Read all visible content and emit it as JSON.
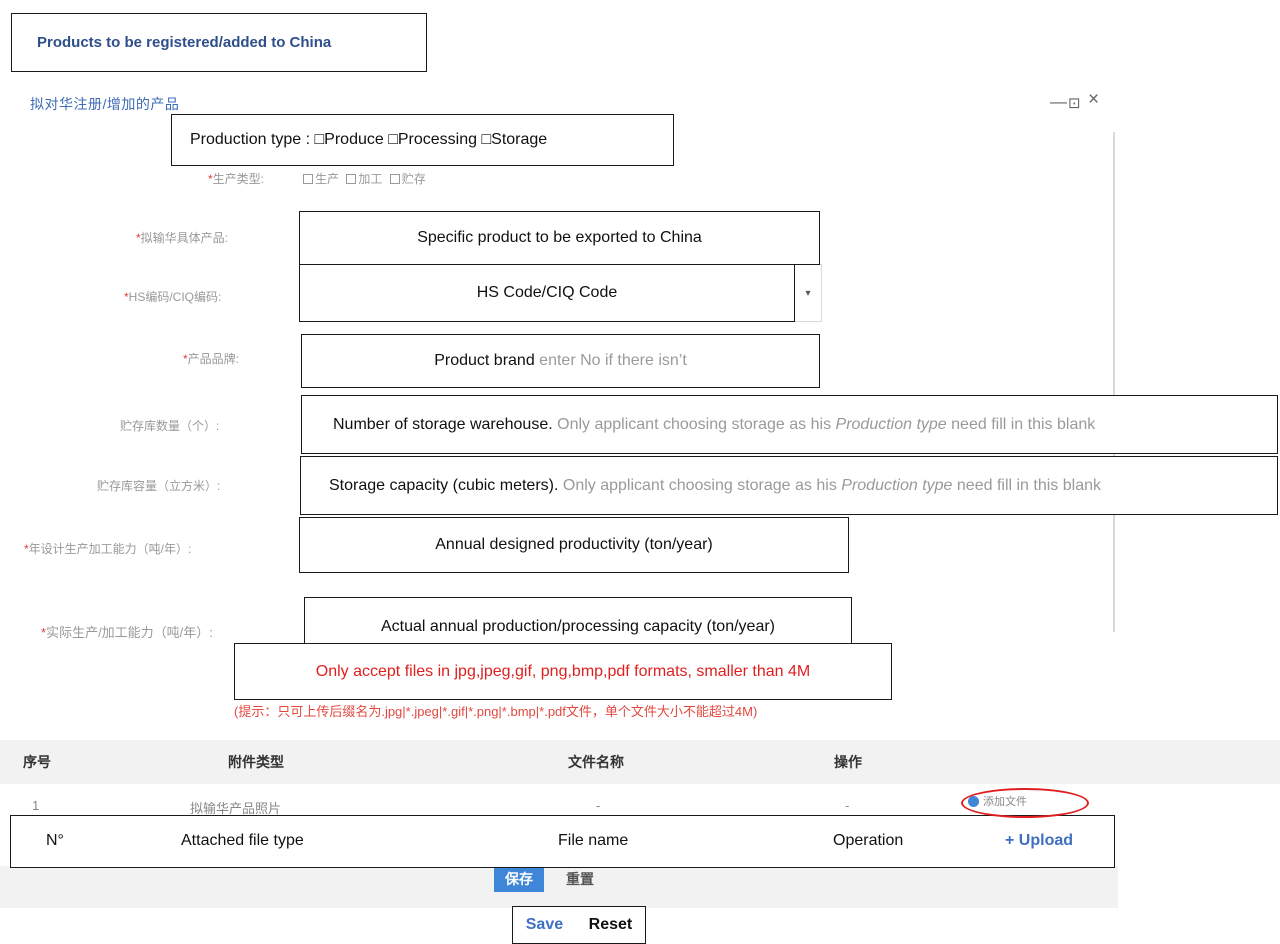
{
  "annotation_title": "Products to be registered/added to China",
  "dialog": {
    "title_cn": "拟对华注册/增加的产品",
    "controls": {
      "minimize": "—",
      "maximize": "⊡",
      "close": "×"
    }
  },
  "fields": {
    "production_type": {
      "label_cn": "生产类型:",
      "options_cn": [
        "生产",
        "加工",
        "贮存"
      ],
      "annotation": "Production type : □Produce □Processing □Storage"
    },
    "specific_product": {
      "label_cn": "拟输华具体产品:",
      "annotation": "Specific product to be exported to China"
    },
    "hs_code": {
      "label_cn": "HS编码/CIQ编码:",
      "annotation": "HS Code/CIQ Code",
      "dropdown_glyph": "▾"
    },
    "brand": {
      "label_cn": "产品品牌:",
      "annotation": "Product brand",
      "hint": "enter No if there isn’t"
    },
    "warehouse_count": {
      "label_cn": "贮存库数量（个）:",
      "annotation": "Number of storage warehouse.",
      "hint_prefix": "Only applicant choosing storage as his",
      "hint_em": "Production type",
      "hint_suffix": "need fill in this blank"
    },
    "storage_capacity": {
      "label_cn": "贮存库容量（立方米）:",
      "annotation": "Storage capacity (cubic meters).",
      "hint_prefix": "Only applicant choosing storage as his",
      "hint_em": "Production type",
      "hint_suffix": "need fill in this blank"
    },
    "designed_productivity": {
      "label_cn": "年设计生产加工能力（吨/年）:",
      "annotation": "Annual designed productivity (ton/year)"
    },
    "actual_capacity": {
      "label_cn": "实际生产/加工能力（吨/年）:",
      "annotation": "Actual annual production/processing capacity (ton/year)"
    }
  },
  "upload_tip": {
    "en": "Only accept files in jpg,jpeg,gif, png,bmp,pdf formats, smaller than 4M",
    "cn": "(提示：只可上传后缀名为.jpg|*.jpeg|*.gif|*.png|*.bmp|*.pdf文件，单个文件大小不能超过4M)"
  },
  "table_cn": {
    "headers": [
      "序号",
      "附件类型",
      "文件名称",
      "操作"
    ],
    "row": {
      "index": "1",
      "type": "拟输华产品照片",
      "file": "-",
      "op": "-",
      "add_file": "添加文件"
    }
  },
  "table_en": {
    "headers": [
      "N°",
      "Attached file type",
      "File name",
      "Operation"
    ],
    "upload": "+ Upload"
  },
  "buttons_cn": {
    "save": "保存",
    "reset": "重置"
  },
  "buttons_en": {
    "save": "Save",
    "reset": "Reset"
  }
}
